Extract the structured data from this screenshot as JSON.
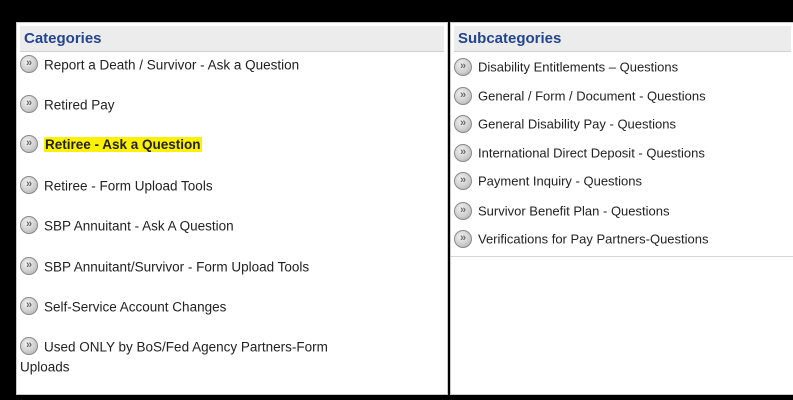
{
  "categories": {
    "title": "Categories",
    "items": [
      {
        "label": "Report a Death / Survivor - Ask a Question"
      },
      {
        "label": "Retired Pay"
      },
      {
        "label": "Retiree - Ask a Question"
      },
      {
        "label": "Retiree - Form Upload Tools"
      },
      {
        "label": "SBP Annuitant - Ask A Question"
      },
      {
        "label": "SBP Annuitant/Survivor - Form Upload Tools"
      },
      {
        "label": "Self-Service Account Changes"
      },
      {
        "label": "Used ONLY by BoS/Fed Agency Partners-Form Uploads"
      }
    ],
    "highlight_color": "#fff200"
  },
  "subcategories": {
    "title": "Subcategories",
    "items": [
      {
        "label": "Disability Entitlements – Questions"
      },
      {
        "label": "General / Form / Document - Questions"
      },
      {
        "label": "General Disability Pay - Questions"
      },
      {
        "label": "International Direct Deposit - Questions"
      },
      {
        "label": "Payment Inquiry - Questions"
      },
      {
        "label": "Survivor Benefit Plan - Questions"
      },
      {
        "label": "Verifications for Pay Partners-Questions"
      }
    ]
  },
  "colors": {
    "header_text": "#24458f",
    "header_bg": "#ececec",
    "frame": "#000000"
  }
}
